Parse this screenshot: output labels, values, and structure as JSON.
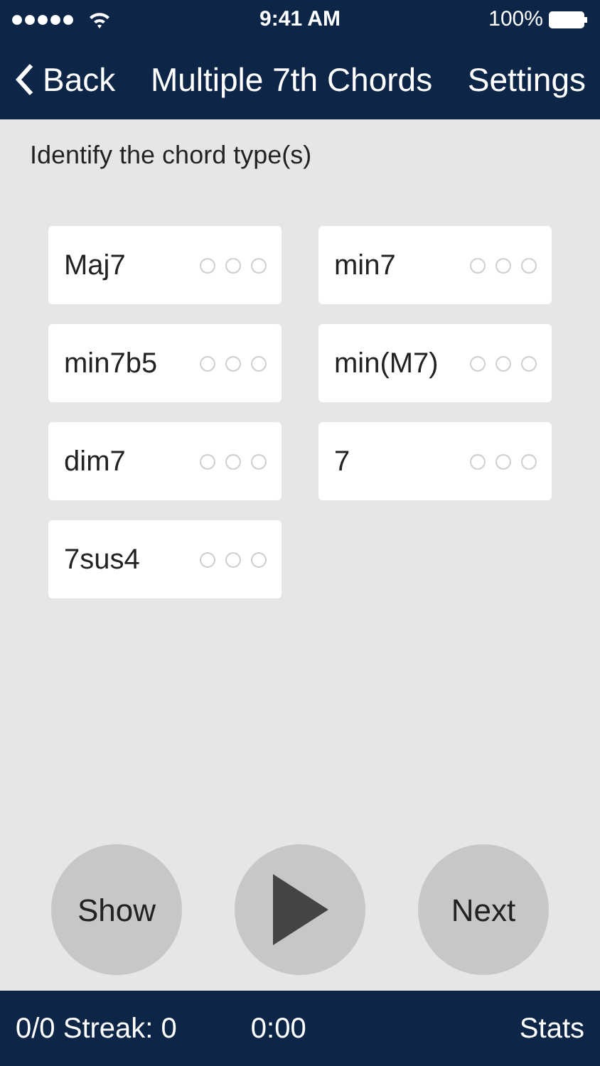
{
  "status_bar": {
    "time": "9:41 AM",
    "battery": "100%"
  },
  "nav_bar": {
    "back": "Back",
    "title": "Multiple 7th Chords",
    "settings": "Settings"
  },
  "prompt": "Identify the chord type(s)",
  "chords": [
    {
      "label": "Maj7",
      "selected": false
    },
    {
      "label": "min7",
      "selected": false
    },
    {
      "label": "min7b5",
      "selected": false
    },
    {
      "label": "min(M7)",
      "selected": false
    },
    {
      "label": "dim7",
      "selected": false
    },
    {
      "label": "7",
      "selected": false
    },
    {
      "label": "7sus4",
      "selected": false
    }
  ],
  "controls": {
    "show": "Show",
    "next": "Next"
  },
  "footer": {
    "score": "0/0 Streak: 0",
    "timer": "0:00",
    "stats": "Stats"
  }
}
